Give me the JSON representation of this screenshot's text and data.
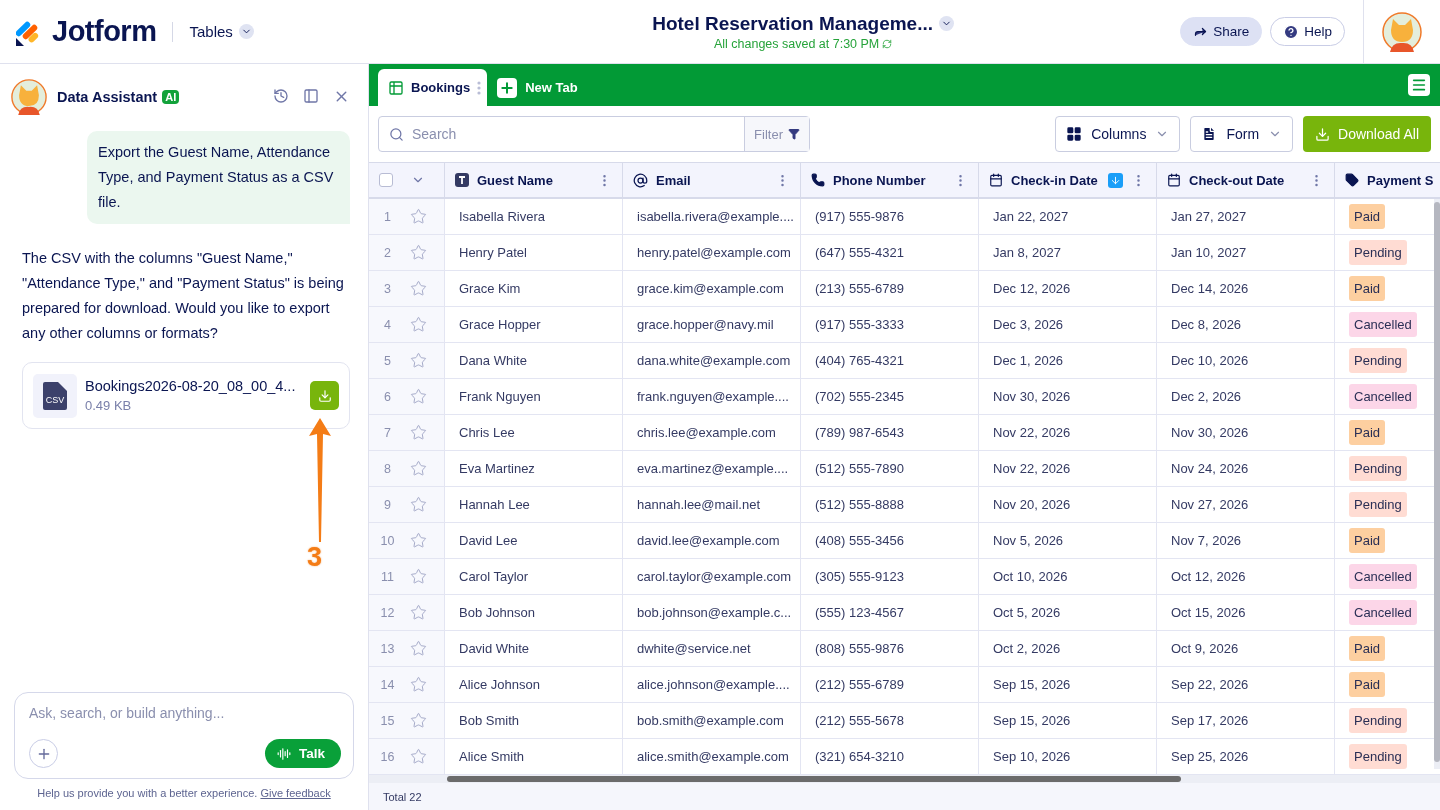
{
  "header": {
    "brand": "Jotform",
    "product": "Tables",
    "title": "Hotel Reservation Manageme...",
    "save_status": "All changes saved at 7:30 PM",
    "buttons": [
      "Share",
      "Help"
    ]
  },
  "assistant": {
    "title": "Data Assistant",
    "badge": "AI",
    "messages": [
      {
        "kind": "user",
        "text": "Export the Guest Name, Attendance Type, and Payment Status as a CSV file."
      },
      {
        "kind": "bot",
        "text": "The CSV with the columns \"Guest Name,\" \"Attendance Type,\" and \"Payment Status\" is being prepared for download. Would you like to export any other columns or formats?"
      }
    ],
    "file": {
      "type": "CSV",
      "name": "Bookings2026-08-20_08_00_4...",
      "size": "0.49 KB"
    },
    "annotation": {
      "label": "3"
    },
    "input": {
      "placeholder": "Ask, search, or build anything..."
    },
    "talk_button": "Talk",
    "feedback": {
      "text": "Help us provide you with a better experience.",
      "link": "Give feedback"
    }
  },
  "tabs": [
    {
      "label": "Bookings",
      "selected": true
    }
  ],
  "new_tab": "New Tab",
  "toolbar": {
    "search": {
      "placeholder": "Search"
    },
    "filter": "Filter",
    "buttons": [
      "Columns",
      "Form"
    ],
    "download": "Download All"
  },
  "table": {
    "select_all": {
      "checked": false
    },
    "columns": [
      {
        "label": "Guest Name",
        "kind": "text",
        "sorted": false
      },
      {
        "label": "Email",
        "kind": "email",
        "sorted": false
      },
      {
        "label": "Phone Number",
        "kind": "phone",
        "sorted": false
      },
      {
        "label": "Check-in Date",
        "kind": "date",
        "sorted": true
      },
      {
        "label": "Check-out Date",
        "kind": "date",
        "sorted": false
      },
      {
        "label": "Payment S",
        "kind": "tag",
        "sorted": false
      }
    ],
    "rows": [
      {
        "n": "1",
        "cells": [
          "Isabella Rivera",
          "isabella.rivera@example....",
          "(917) 555-9876",
          "Jan 22, 2027",
          "Jan 27, 2027"
        ],
        "status": {
          "text": "Paid",
          "color": "#fdcfa0"
        }
      },
      {
        "n": "2",
        "cells": [
          "Henry Patel",
          "henry.patel@example.com",
          "(647) 555-4321",
          "Jan 8, 2027",
          "Jan 10, 2027"
        ],
        "status": {
          "text": "Pending",
          "color": "#ffdcd3"
        }
      },
      {
        "n": "3",
        "cells": [
          "Grace Kim",
          "grace.kim@example.com",
          "(213) 555-6789",
          "Dec 12, 2026",
          "Dec 14, 2026"
        ],
        "status": {
          "text": "Paid",
          "color": "#fdcfa0"
        }
      },
      {
        "n": "4",
        "cells": [
          "Grace Hopper",
          "grace.hopper@navy.mil",
          "(917) 555-3333",
          "Dec 3, 2026",
          "Dec 8, 2026"
        ],
        "status": {
          "text": "Cancelled",
          "color": "#fcd6e8"
        }
      },
      {
        "n": "5",
        "cells": [
          "Dana White",
          "dana.white@example.com",
          "(404) 765-4321",
          "Dec 1, 2026",
          "Dec 10, 2026"
        ],
        "status": {
          "text": "Pending",
          "color": "#ffdcd3"
        }
      },
      {
        "n": "6",
        "cells": [
          "Frank Nguyen",
          "frank.nguyen@example....",
          "(702) 555-2345",
          "Nov 30, 2026",
          "Dec 2, 2026"
        ],
        "status": {
          "text": "Cancelled",
          "color": "#fcd6e8"
        }
      },
      {
        "n": "7",
        "cells": [
          "Chris Lee",
          "chris.lee@example.com",
          "(789) 987-6543",
          "Nov 22, 2026",
          "Nov 30, 2026"
        ],
        "status": {
          "text": "Paid",
          "color": "#fdcfa0"
        }
      },
      {
        "n": "8",
        "cells": [
          "Eva Martinez",
          "eva.martinez@example....",
          "(512) 555-7890",
          "Nov 22, 2026",
          "Nov 24, 2026"
        ],
        "status": {
          "text": "Pending",
          "color": "#ffdcd3"
        }
      },
      {
        "n": "9",
        "cells": [
          "Hannah Lee",
          "hannah.lee@mail.net",
          "(512) 555-8888",
          "Nov 20, 2026",
          "Nov 27, 2026"
        ],
        "status": {
          "text": "Pending",
          "color": "#ffdcd3"
        }
      },
      {
        "n": "10",
        "cells": [
          "David Lee",
          "david.lee@example.com",
          "(408) 555-3456",
          "Nov 5, 2026",
          "Nov 7, 2026"
        ],
        "status": {
          "text": "Paid",
          "color": "#fdcfa0"
        }
      },
      {
        "n": "11",
        "cells": [
          "Carol Taylor",
          "carol.taylor@example.com",
          "(305) 555-9123",
          "Oct 10, 2026",
          "Oct 12, 2026"
        ],
        "status": {
          "text": "Cancelled",
          "color": "#fcd6e8"
        }
      },
      {
        "n": "12",
        "cells": [
          "Bob Johnson",
          "bob.johnson@example.c...",
          "(555) 123-4567",
          "Oct 5, 2026",
          "Oct 15, 2026"
        ],
        "status": {
          "text": "Cancelled",
          "color": "#fcd6e8"
        }
      },
      {
        "n": "13",
        "cells": [
          "David White",
          "dwhite@service.net",
          "(808) 555-9876",
          "Oct 2, 2026",
          "Oct 9, 2026"
        ],
        "status": {
          "text": "Paid",
          "color": "#fdcfa0"
        }
      },
      {
        "n": "14",
        "cells": [
          "Alice Johnson",
          "alice.johnson@example....",
          "(212) 555-6789",
          "Sep 15, 2026",
          "Sep 22, 2026"
        ],
        "status": {
          "text": "Paid",
          "color": "#fdcfa0"
        }
      },
      {
        "n": "15",
        "cells": [
          "Bob Smith",
          "bob.smith@example.com",
          "(212) 555-5678",
          "Sep 15, 2026",
          "Sep 17, 2026"
        ],
        "status": {
          "text": "Pending",
          "color": "#ffdcd3"
        }
      },
      {
        "n": "16",
        "cells": [
          "Alice Smith",
          "alice.smith@example.com",
          "(321) 654-3210",
          "Sep 10, 2026",
          "Sep 25, 2026"
        ],
        "status": {
          "text": "Pending",
          "color": "#ffdcd3"
        }
      }
    ],
    "total": "Total 22"
  }
}
